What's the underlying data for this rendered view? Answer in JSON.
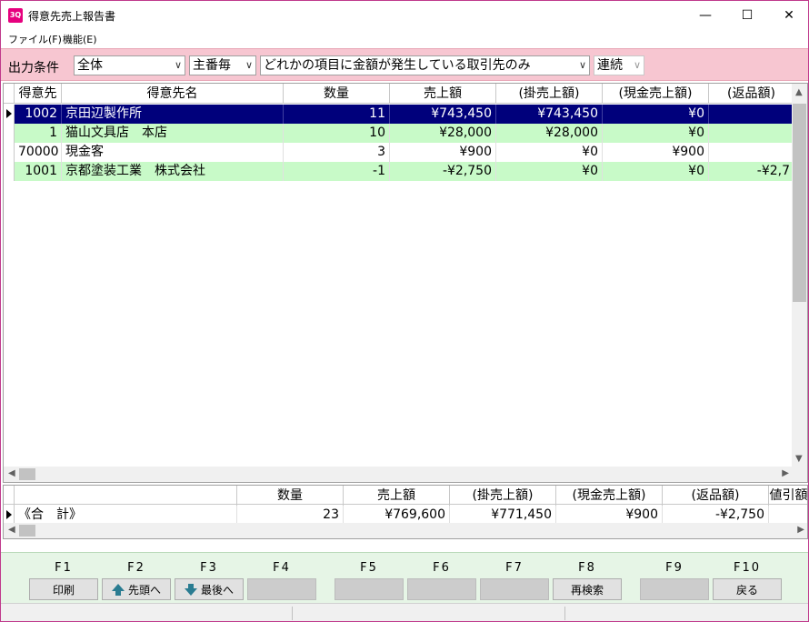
{
  "window": {
    "title": "得意先売上報告書",
    "icon_text": "3Q",
    "minimize_glyph": "—",
    "maximize_glyph": "☐",
    "close_glyph": "✕"
  },
  "menu": {
    "items": [
      "ファイル(F)",
      "機能(E)"
    ]
  },
  "conditions": {
    "label": "出力条件",
    "scope": "全体",
    "sort": "主番毎",
    "filter": "どれかの項目に金額が発生している取引先のみ",
    "mode": "連続"
  },
  "grid": {
    "columns": [
      "得意先",
      "得意先名",
      "数量",
      "売上額",
      "(掛売上額)",
      "(現金売上額)",
      "(返品額)"
    ],
    "rows": [
      {
        "code": "1002",
        "name": "京田辺製作所",
        "qty": "11",
        "sales": "¥743,450",
        "credit": "¥743,450",
        "cash": "¥0",
        "returns": ""
      },
      {
        "code": "1",
        "name": "猫山文具店　本店",
        "qty": "10",
        "sales": "¥28,000",
        "credit": "¥28,000",
        "cash": "¥0",
        "returns": ""
      },
      {
        "code": "70000",
        "name": "現金客",
        "qty": "3",
        "sales": "¥900",
        "credit": "¥0",
        "cash": "¥900",
        "returns": ""
      },
      {
        "code": "1001",
        "name": "京都塗装工業　株式会社",
        "qty": "-1",
        "sales": "-¥2,750",
        "credit": "¥0",
        "cash": "¥0",
        "returns": "-¥2,7"
      }
    ]
  },
  "totals": {
    "columns": [
      "数量",
      "売上額",
      "(掛売上額)",
      "(現金売上額)",
      "(返品額)",
      "値引額"
    ],
    "label": "《合　計》",
    "qty": "23",
    "sales": "¥769,600",
    "credit": "¥771,450",
    "cash": "¥900",
    "returns": "-¥2,750"
  },
  "fkeys": [
    {
      "key": "F1",
      "label": "印刷"
    },
    {
      "key": "F2",
      "label": "先頭へ",
      "icon": "arrow-up-icon"
    },
    {
      "key": "F3",
      "label": "最後へ",
      "icon": "arrow-down-icon"
    },
    {
      "key": "F4",
      "label": ""
    },
    {
      "key": "F5",
      "label": ""
    },
    {
      "key": "F6",
      "label": ""
    },
    {
      "key": "F7",
      "label": ""
    },
    {
      "key": "F8",
      "label": "再検索"
    },
    {
      "key": "F9",
      "label": ""
    },
    {
      "key": "F10",
      "label": "戻る"
    }
  ],
  "colors": {
    "condition_bar": "#f7c6d1",
    "selected_row": "#00007b",
    "alt_row": "#c8fac8",
    "fkey_panel": "#e6f5e6",
    "window_border": "#c03a8c"
  }
}
